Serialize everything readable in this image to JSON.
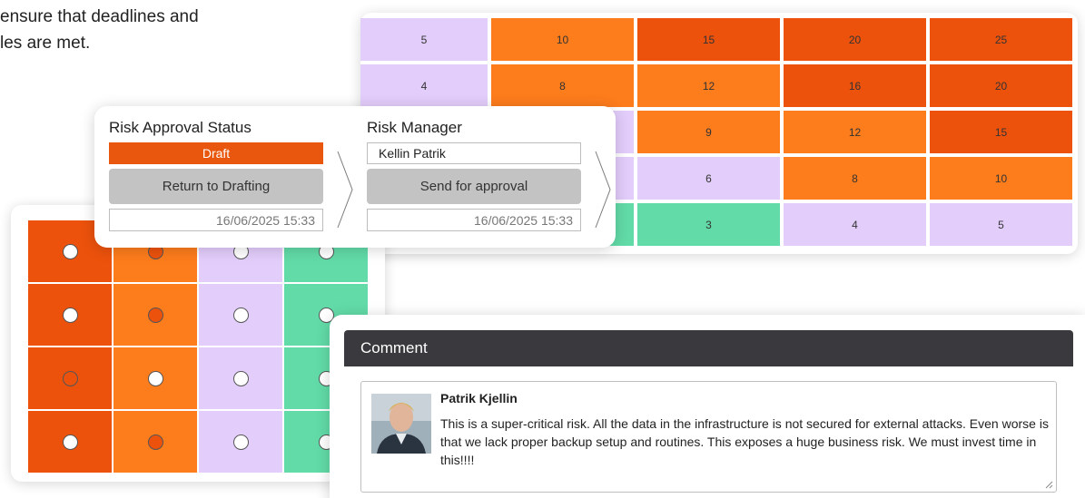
{
  "intro": {
    "text": "ensure that deadlines and\nles are met."
  },
  "heat_matrix": {
    "rows": [
      [
        {
          "value": "5",
          "color": "#e3cdfb"
        },
        {
          "value": "10",
          "color": "#fd7c1c"
        },
        {
          "value": "15",
          "color": "#ec520c"
        },
        {
          "value": "20",
          "color": "#ec520c"
        },
        {
          "value": "25",
          "color": "#ec520c"
        }
      ],
      [
        {
          "value": "4",
          "color": "#e3cdfb"
        },
        {
          "value": "8",
          "color": "#fd7c1c"
        },
        {
          "value": "12",
          "color": "#fd7c1c"
        },
        {
          "value": "16",
          "color": "#ec520c"
        },
        {
          "value": "20",
          "color": "#ec520c"
        }
      ],
      [
        {
          "value": "",
          "color": "#e3cdfb"
        },
        {
          "value": "",
          "color": "#e3cdfb"
        },
        {
          "value": "9",
          "color": "#fd7c1c"
        },
        {
          "value": "12",
          "color": "#fd7c1c"
        },
        {
          "value": "15",
          "color": "#ec520c"
        }
      ],
      [
        {
          "value": "",
          "color": "#e3cdfb"
        },
        {
          "value": "",
          "color": "#e3cdfb"
        },
        {
          "value": "6",
          "color": "#e3cdfb"
        },
        {
          "value": "8",
          "color": "#fd7c1c"
        },
        {
          "value": "10",
          "color": "#fd7c1c"
        }
      ],
      [
        {
          "value": "",
          "color": "#62dba8"
        },
        {
          "value": "",
          "color": "#62dba8"
        },
        {
          "value": "3",
          "color": "#62dba8"
        },
        {
          "value": "4",
          "color": "#e3cdfb"
        },
        {
          "value": "5",
          "color": "#e3cdfb"
        }
      ]
    ]
  },
  "dot_matrix": {
    "column_colors": [
      "#ec520c",
      "#fd7c1c",
      "#e3cdfb",
      "#62dba8"
    ],
    "dots": [
      [
        "#ffffff",
        "#ec520c",
        "#ffffff",
        "#ffffff"
      ],
      [
        "#ffffff",
        "#ec520c",
        "#ffffff",
        "#ffffff"
      ],
      [
        "#ec520c",
        "#ffffff",
        "#ffffff",
        "#ffffff"
      ],
      [
        "#ffffff",
        "#ec520c",
        "#ffffff",
        "#ffffff"
      ]
    ]
  },
  "approval": {
    "status": {
      "title": "Risk Approval Status",
      "value": "Draft",
      "button_label": "Return to Drafting",
      "timestamp": "16/06/2025 15:33",
      "color": "#e9560d"
    },
    "manager": {
      "title": "Risk Manager",
      "value": "Kellin Patrik",
      "button_label": "Send for approval",
      "timestamp": "16/06/2025 15:33"
    }
  },
  "comment": {
    "header": "Comment",
    "author": "Patrik Kjellin",
    "text": "This is a super-critical risk. All the data in the infrastructure is not secured for external attacks. Even worse is that we lack proper backup setup and routines. This exposes a huge business risk. We must invest time in this!!!!"
  }
}
